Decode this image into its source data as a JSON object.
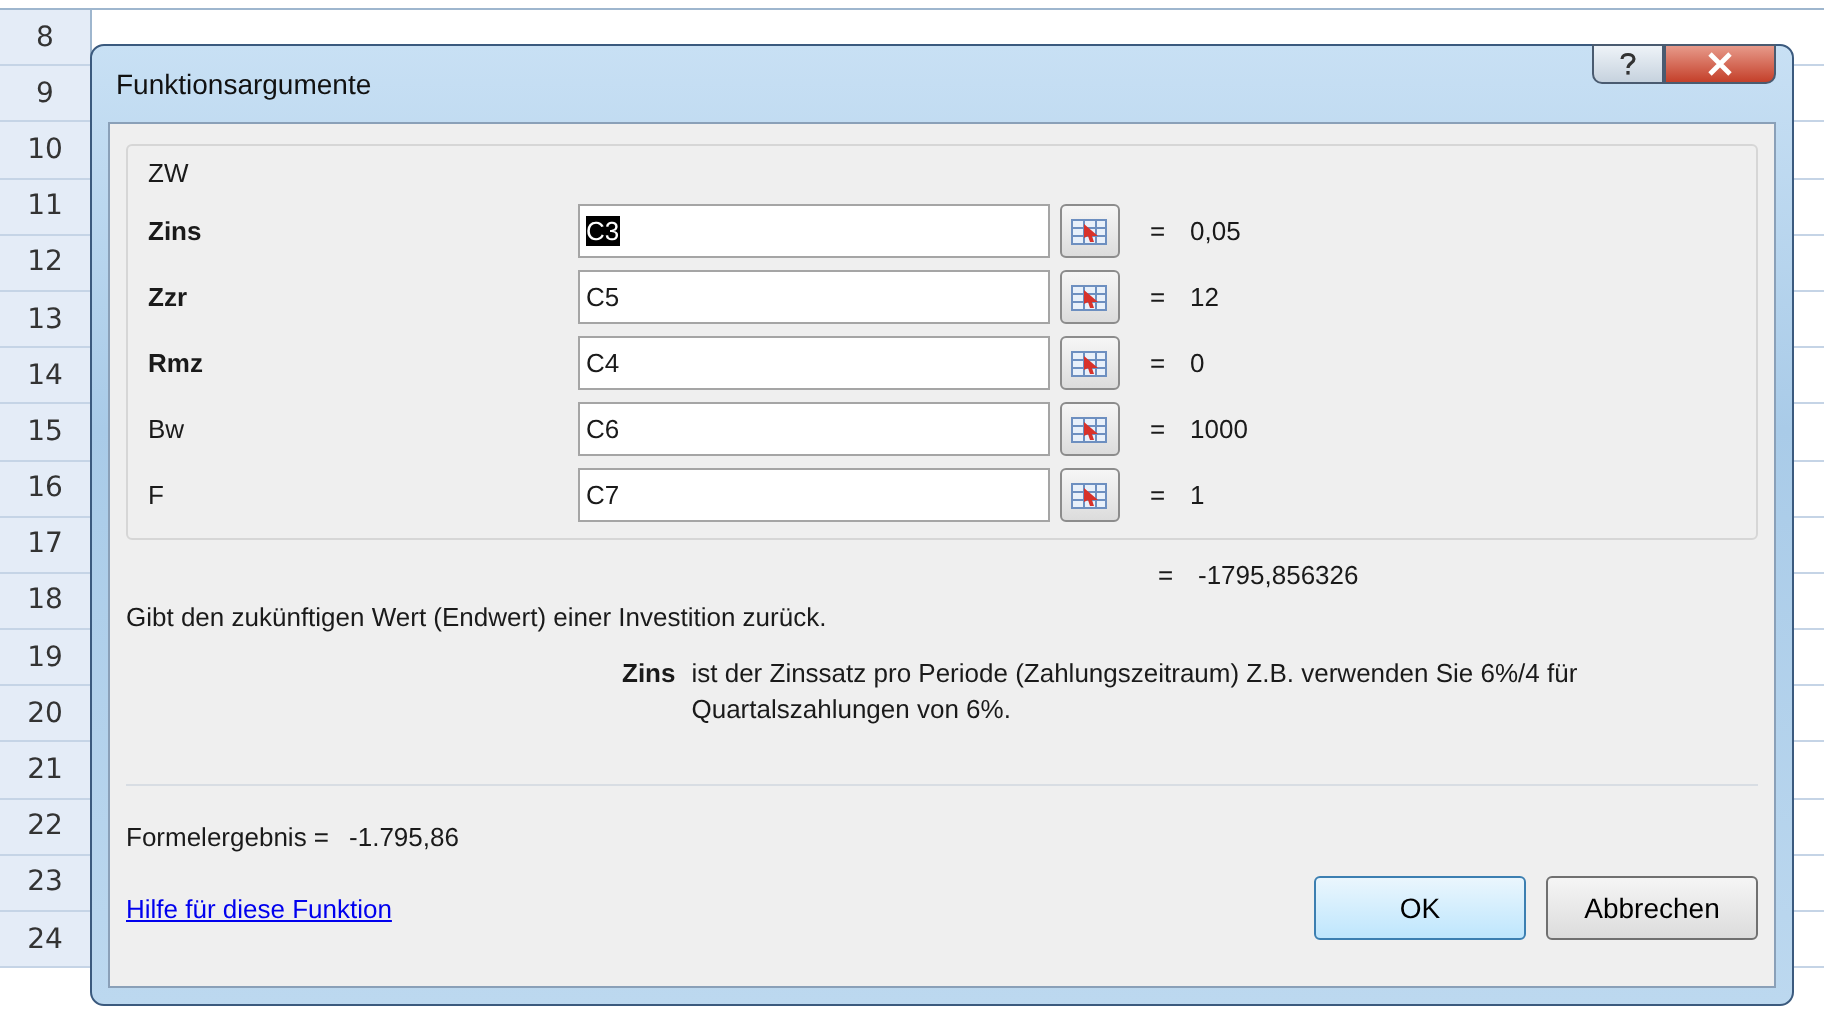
{
  "sheet": {
    "row_headers": [
      "8",
      "9",
      "10",
      "11",
      "12",
      "13",
      "14",
      "15",
      "16",
      "17",
      "18",
      "19",
      "20",
      "21",
      "22",
      "23",
      "24"
    ]
  },
  "window": {
    "title": "Funktionsargumente"
  },
  "group": {
    "title": "ZW",
    "arguments": [
      {
        "label": "Zins",
        "required": true,
        "value": "C3",
        "selected": true,
        "equals": "=",
        "result": "0,05"
      },
      {
        "label": "Zzr",
        "required": true,
        "value": "C5",
        "selected": false,
        "equals": "=",
        "result": "12"
      },
      {
        "label": "Rmz",
        "required": true,
        "value": "C4",
        "selected": false,
        "equals": "=",
        "result": "0"
      },
      {
        "label": "Bw",
        "required": false,
        "value": "C6",
        "selected": false,
        "equals": "=",
        "result": "1000"
      },
      {
        "label": "F",
        "required": false,
        "value": "C7",
        "selected": false,
        "equals": "=",
        "result": "1"
      }
    ]
  },
  "result": {
    "equals": "=",
    "value": "-1795,856326"
  },
  "description": "Gibt den zukünftigen Wert (Endwert) einer Investition zurück.",
  "argument_help": {
    "name": "Zins",
    "text": "ist der Zinssatz pro Periode (Zahlungszeitraum) Z.B. verwenden Sie 6%/4 für Quartalszahlungen von 6%."
  },
  "formula_result": {
    "label": "Formelergebnis =",
    "value": "-1.795,86"
  },
  "help_link": "Hilfe für diese Funktion",
  "buttons": [
    "OK",
    "Abbrechen"
  ]
}
